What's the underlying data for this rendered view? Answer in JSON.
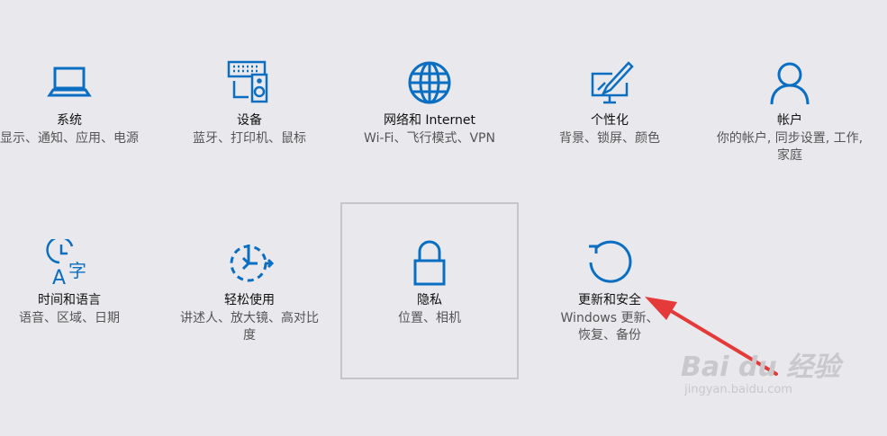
{
  "tiles": [
    {
      "title": "系统",
      "desc": "显示、通知、应用、电源",
      "icon": "laptop-icon"
    },
    {
      "title": "设备",
      "desc": "蓝牙、打印机、鼠标",
      "icon": "devices-icon"
    },
    {
      "title": "网络和 Internet",
      "desc": "Wi-Fi、飞行模式、VPN",
      "icon": "globe-icon"
    },
    {
      "title": "个性化",
      "desc": "背景、锁屏、颜色",
      "icon": "paint-icon"
    },
    {
      "title": "帐户",
      "desc": "你的帐户, 同步设置, 工作, 家庭",
      "icon": "person-icon"
    },
    {
      "title": "时间和语言",
      "desc": "语音、区域、日期",
      "icon": "time-language-icon"
    },
    {
      "title": "轻松使用",
      "desc": "讲述人、放大镜、高对比度",
      "icon": "ease-of-access-icon"
    },
    {
      "title": "隐私",
      "desc": "位置、相机",
      "icon": "lock-icon"
    },
    {
      "title": "更新和安全",
      "desc": "Windows 更新、恢复、备份",
      "icon": "update-icon"
    }
  ],
  "colors": {
    "accent": "#0a6fc2",
    "annotation": "#e43a3a",
    "background": "#e9e8ec"
  },
  "watermark": {
    "brand": "Bai du 经验",
    "url": "jingyan.baidu.com"
  }
}
